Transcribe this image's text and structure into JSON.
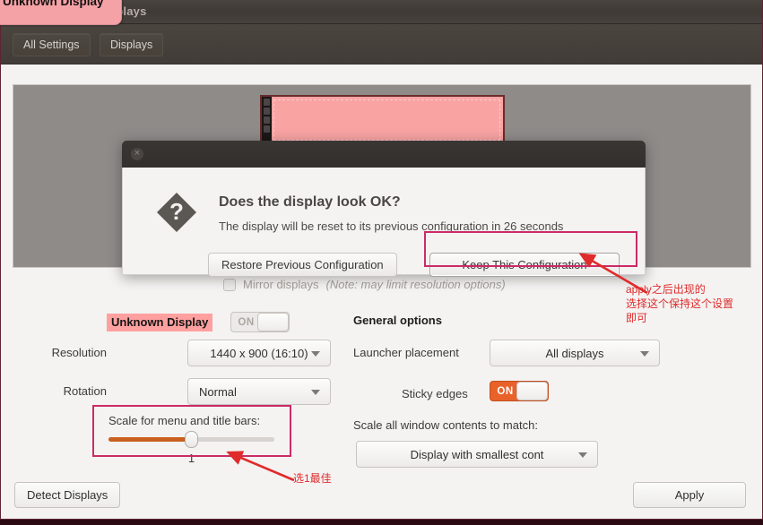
{
  "window": {
    "title": "Displays",
    "toolbar": {
      "all_settings": "All Settings",
      "displays": "Displays"
    }
  },
  "overlay_tab": {
    "label": "Unknown Display"
  },
  "preview": {
    "monitor_label": ""
  },
  "mirror": {
    "label": "Mirror displays",
    "note": "(Note: may limit resolution options)"
  },
  "display_panel": {
    "name": "Unknown Display",
    "power_toggle": "ON",
    "resolution_label": "Resolution",
    "resolution_value": "1440 x 900 (16:10)",
    "rotation_label": "Rotation",
    "rotation_value": "Normal",
    "scale_label": "Scale for menu and title bars:",
    "scale_value": "1"
  },
  "general_options": {
    "heading": "General options",
    "launcher_label": "Launcher placement",
    "launcher_value": "All displays",
    "sticky_label": "Sticky edges",
    "sticky_toggle": "ON",
    "scale_all_label": "Scale all window contents to match:",
    "scale_all_value": "Display with smallest cont"
  },
  "footer": {
    "detect_displays": "Detect Displays",
    "apply": "Apply"
  },
  "dialog": {
    "title": "Does the display look OK?",
    "subtitle": "The display will be reset to its previous configuration in 26 seconds",
    "restore_button": "Restore Previous Configuration",
    "keep_button": "Keep This Configuration",
    "close_icon": "×"
  },
  "annotations": {
    "keep_note": "apply之后出现的\n选择这个保持这个设置\n即可",
    "scale_note": "选1最佳",
    "highlight_color": "#cc2a66",
    "arrow_color": "#e02b2b"
  },
  "colors": {
    "accent_orange": "#e8622a",
    "pink_highlight": "#ffa0a0",
    "titlebar": "#3f3a36",
    "panel_bg": "#f4f3f2"
  }
}
